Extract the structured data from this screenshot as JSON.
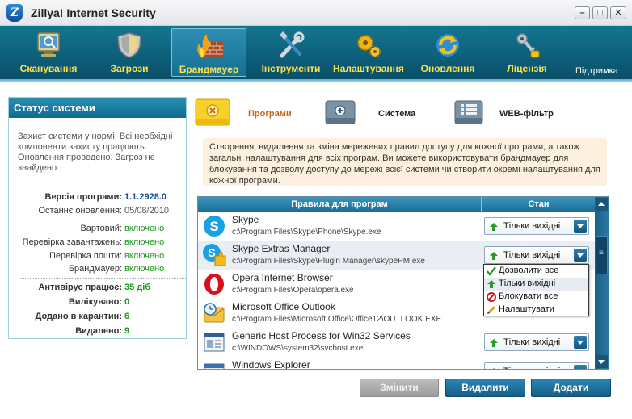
{
  "window": {
    "title": "Zillya! Internet Security",
    "logo_letter": "Z",
    "minimize": "–",
    "maximize": "□",
    "close": "✕"
  },
  "toolbar": {
    "items": [
      {
        "label": "Сканування",
        "icon": "scan-monitor-icon"
      },
      {
        "label": "Загрози",
        "icon": "shield-icon"
      },
      {
        "label": "Брандмауер",
        "icon": "firewall-icon",
        "active": true
      },
      {
        "label": "Інструменти",
        "icon": "tools-icon"
      },
      {
        "label": "Налаштування",
        "icon": "gears-icon"
      },
      {
        "label": "Оновлення",
        "icon": "update-icon"
      },
      {
        "label": "Ліцензія",
        "icon": "key-icon"
      }
    ],
    "support": "Підтримка"
  },
  "status": {
    "header": "Статус системи",
    "message": "Захист системи у нормі. Всі необхідні компоненти захисту працюють. Оновлення проведено. Загроз не знайдено.",
    "version_label": "Версія програми:",
    "version_value": "1.1.2928.0",
    "update_label": "Останнє оновлення:",
    "update_value": "05/08/2010",
    "guard_label": "Вартовий:",
    "guard_value": "включено",
    "boot_label": "Перевірка завантажень:",
    "boot_value": "включено",
    "mail_label": "Перевірка пошти:",
    "mail_value": "включено",
    "firewall_label": "Брандмауер:",
    "firewall_value": "включено",
    "av_label": "Антивірус працює:",
    "av_value": "35 діб",
    "cured_label": "Вилікувано:",
    "cured_value": "0",
    "quarantine_label": "Додано в карантин:",
    "quarantine_value": "6",
    "deleted_label": "Видалено:",
    "deleted_value": "9"
  },
  "subtabs": {
    "programs": "Програми",
    "system": "Система",
    "web": "WEB-фільтр"
  },
  "info": "Створення, видалення та зміна мережевих правил доступу для кожної програми, а також загальні налаштування для всіх програм. Ви можете використовувати брандмауер для блокування та дозволу доступу до мережі всієї системи чи створити окремі налаштування для кожної програми.",
  "table": {
    "col_rules": "Правила для програм",
    "col_state": "Стан",
    "rows": [
      {
        "name": "Skype",
        "path": "c:\\Program Files\\Skype\\Phone\\Skype.exe",
        "state": "Тільки вихідні",
        "icon": "skype-icon"
      },
      {
        "name": "Skype Extras Manager",
        "path": "c:\\Program Files\\Skype\\Plugin Manager\\skypePM.exe",
        "state": "Тільки вихідні",
        "icon": "skype-extras-icon"
      },
      {
        "name": "Opera Internet Browser",
        "path": "c:\\Program Files\\Opera\\opera.exe",
        "state": "Тільки вихідні",
        "icon": "opera-icon"
      },
      {
        "name": "Microsoft Office Outlook",
        "path": "c:\\Program Files\\Microsoft Office\\Office12\\OUTLOOK.EXE",
        "state": "Тільки вихідні",
        "icon": "outlook-icon"
      },
      {
        "name": "Generic Host Process for Win32 Services",
        "path": "c:\\WINDOWS\\system32\\svchost.exe",
        "state": "Тільки вихідні",
        "icon": "svchost-icon"
      },
      {
        "name": "Windows Explorer",
        "path": "",
        "state": "Тільки вихідні",
        "icon": "explorer-icon"
      }
    ]
  },
  "popup": {
    "options": [
      "Дозволити все",
      "Тільки вихідні",
      "Блокувати все",
      "Налаштувати"
    ],
    "highlighted": "Тільки вихідні"
  },
  "buttons": {
    "edit": "Змінити",
    "delete": "Видалити",
    "add": "Додати"
  },
  "colors": {
    "toolbar": "#0d5f7a",
    "toolbar_label": "#ffe24a",
    "ok_green": "#1b9a1b",
    "version_blue": "#1a4e9a",
    "active_subtab": "#c9631a"
  }
}
